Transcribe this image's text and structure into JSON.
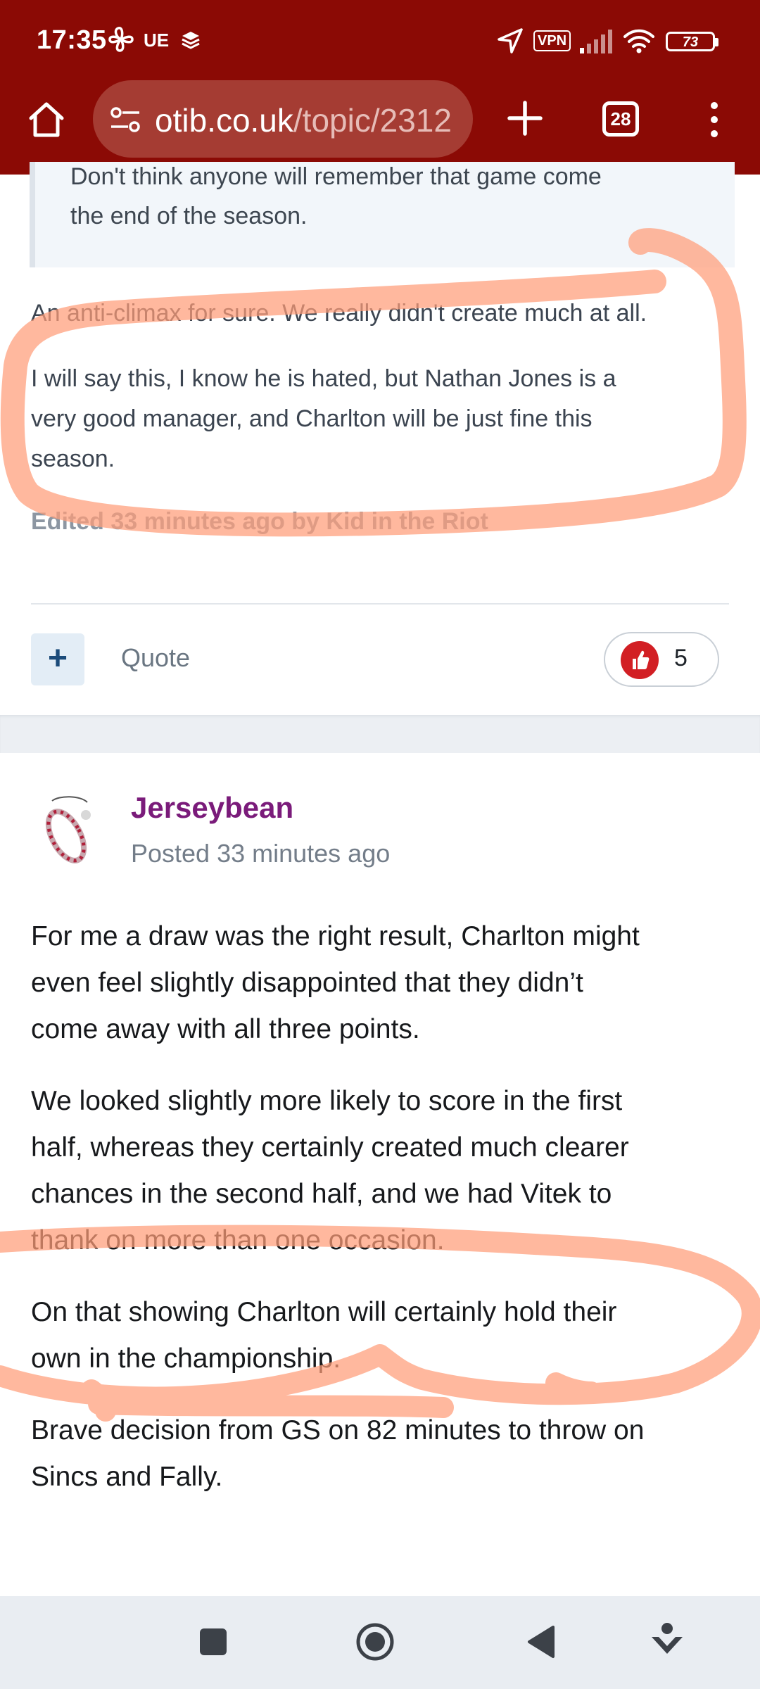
{
  "status_bar": {
    "time": "17:35",
    "carrier": "UE",
    "vpn": "VPN",
    "battery": "73"
  },
  "browser": {
    "url_domain": "otib.co.uk",
    "url_path": "/topic/2312",
    "tab_count": "28",
    "theme_color": "#8b0a05"
  },
  "post1": {
    "quote_lines": [
      "Don't think anyone will remember that game come",
      "the end of the season."
    ],
    "paragraphs": [
      [
        "An anti-climax for sure. We really didn't create much at all."
      ],
      [
        "I will say this, I know he is hated, but Nathan Jones is a",
        "very good manager, and Charlton will be just fine this",
        "season."
      ]
    ],
    "edited": "Edited 33 minutes ago by Kid in the Riot",
    "add_label": "+",
    "quote_label": "Quote",
    "reaction_count": "5"
  },
  "post2": {
    "author": "Jerseybean",
    "posted": "Posted 33 minutes ago",
    "author_color": "#7a1b7a",
    "paragraphs": [
      [
        "For me a draw was the right result, Charlton might",
        "even feel slightly disappointed that they didn’t",
        "come away with all three points."
      ],
      [
        "We looked slightly more likely to score in the first",
        "half, whereas they certainly created much clearer",
        "chances in the second half, and we had Vitek to",
        "thank on more than one occasion."
      ],
      [
        "On that showing Charlton will certainly hold their",
        "own in the championship."
      ],
      [
        "Brave decision from GS on 82 minutes to throw on",
        "Sincs and Fally."
      ]
    ]
  },
  "annotation_color": "#ff9c78"
}
